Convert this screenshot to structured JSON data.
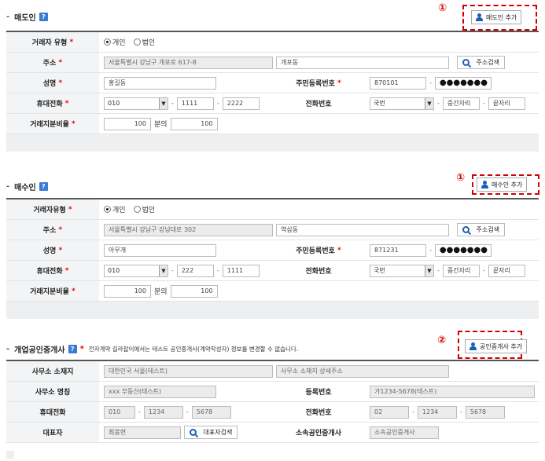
{
  "seller": {
    "title": "매도인",
    "add_button": "매도인 추가",
    "marker": "①",
    "rows": {
      "type_label": "거래자 유형",
      "type_options": [
        "개인",
        "법인"
      ],
      "address_label": "주소",
      "address_value": "서울특별시 강남구 개포로 617-8",
      "address_detail": "개포동",
      "address_search": "주소검색",
      "name_label": "성명",
      "name_value": "홍길동",
      "rrn_label": "주민등록번호",
      "rrn_front": "870101",
      "rrn_back": "●●●●●●●",
      "mobile_label": "휴대전화",
      "mobile_1": "010",
      "mobile_2": "1111",
      "mobile_3": "2222",
      "phone_label": "전화번호",
      "phone_1": "국번",
      "phone_2": "중간자리",
      "phone_3": "끝자리",
      "share_label": "거래지분비율",
      "share_num": "100",
      "share_of": "분의",
      "share_den": "100"
    }
  },
  "buyer": {
    "title": "매수인",
    "add_button": "매수인 추가",
    "marker": "①",
    "rows": {
      "type_label": "거래자유형",
      "type_options": [
        "개인",
        "법인"
      ],
      "address_label": "주소",
      "address_value": "서울특별시 강남구 강남대로 302",
      "address_detail": "역삼동",
      "address_search": "주소검색",
      "name_label": "성명",
      "name_value": "아무개",
      "rrn_label": "주민등록번호",
      "rrn_front": "871231",
      "rrn_back": "●●●●●●●",
      "mobile_label": "휴대전화",
      "mobile_1": "010",
      "mobile_2": "222",
      "mobile_3": "1111",
      "phone_label": "전화번호",
      "phone_1": "국번",
      "phone_2": "중간자리",
      "phone_3": "끝자리",
      "share_label": "거래지분비율",
      "share_num": "100",
      "share_of": "분의",
      "share_den": "100"
    }
  },
  "broker": {
    "title": "개업공인중개사",
    "note": "전자계약 길라잡이에서는 테스트 공인중개사(계약작성자) 정보를 변경할 수 없습니다.",
    "add_button": "공인중개사 추가",
    "marker": "②",
    "rows": {
      "office_addr_label": "사무소 소재지",
      "office_addr_value": "대한민국 서울(테스트)",
      "office_addr_detail": "사무소 소재지 상세주소",
      "office_name_label": "사무소 명칭",
      "office_name_value": "xxx 부동산(테스트)",
      "reg_label": "등록번호",
      "reg_value": "가1234-5678(테스트)",
      "mobile_label": "휴대전화",
      "mobile_1": "010",
      "mobile_2": "1234",
      "mobile_3": "5678",
      "phone_label": "전화번호",
      "phone_1": "02",
      "phone_2": "1234",
      "phone_3": "5678",
      "rep_label": "대표자",
      "rep_value": "최봉현",
      "rep_search": "대표자검색",
      "affil_label": "소속공인중개사",
      "affil_value": "소속공인중개사"
    }
  }
}
